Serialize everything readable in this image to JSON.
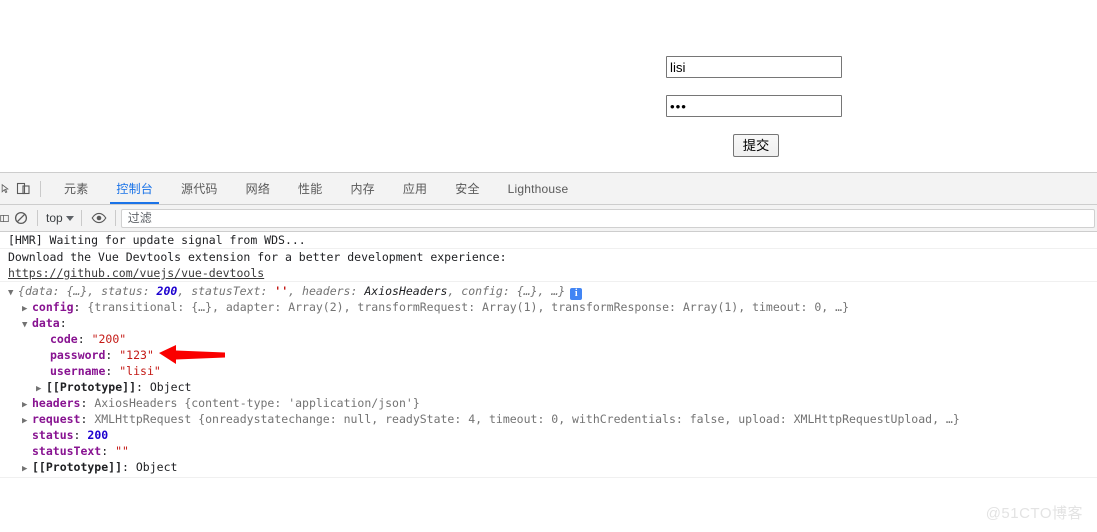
{
  "page": {
    "form": {
      "username_value": "lisi",
      "username_placeholder": "",
      "password_value": "•••",
      "password_placeholder": "",
      "submit_label": "提交"
    }
  },
  "devtools": {
    "left_icons": [
      {
        "name": "inspect-element-icon",
        "glyph": "⌖"
      },
      {
        "name": "device-toolbar-icon",
        "glyph": "device"
      }
    ],
    "tabs": [
      {
        "label": "元素",
        "active": false
      },
      {
        "label": "控制台",
        "active": true
      },
      {
        "label": "源代码",
        "active": false
      },
      {
        "label": "网络",
        "active": false
      },
      {
        "label": "性能",
        "active": false
      },
      {
        "label": "内存",
        "active": false
      },
      {
        "label": "应用",
        "active": false
      },
      {
        "label": "安全",
        "active": false
      },
      {
        "label": "Lighthouse",
        "active": false
      }
    ],
    "filterbar": {
      "clear_console_icon": "no-entry-icon",
      "context_label": "top",
      "eye_icon": "eye-icon",
      "filter_placeholder": "过滤",
      "filter_value": ""
    },
    "console": {
      "messages": [
        {
          "type": "log",
          "text": "[HMR] Waiting for update signal from WDS..."
        },
        {
          "type": "log-with-link",
          "text": "Download the Vue Devtools extension for a better development experience:",
          "link": "https://github.com/vuejs/vue-devtools"
        }
      ],
      "object_summary": {
        "prefix": "{",
        "parts": [
          {
            "key": "data",
            "value": "{…}"
          },
          {
            "key": "status",
            "value": "200"
          },
          {
            "key": "statusText",
            "value": "''"
          },
          {
            "key": "headers",
            "value": "AxiosHeaders"
          },
          {
            "key": "config",
            "value": "{…}"
          }
        ],
        "ellipsis": "…}",
        "info_badge": "i"
      },
      "tree": [
        {
          "indent": 1,
          "marker": "collapsed",
          "key": "config",
          "sep": ": ",
          "value": "{transitional: {…}, adapter: Array(2), transformRequest: Array(1), transformResponse: Array(1), timeout: 0, …}"
        },
        {
          "indent": 1,
          "marker": "expanded",
          "key": "data",
          "sep": ":",
          "value": ""
        },
        {
          "indent": 3,
          "marker": "none",
          "key": "code",
          "sep": ": ",
          "value": "\"200\"",
          "value_kind": "string"
        },
        {
          "indent": 3,
          "marker": "none",
          "key": "password",
          "sep": ": ",
          "value": "\"123\"",
          "value_kind": "string"
        },
        {
          "indent": 3,
          "marker": "none",
          "key": "username",
          "sep": ": ",
          "value": "\"lisi\"",
          "value_kind": "string"
        },
        {
          "indent": 2,
          "marker": "collapsed",
          "key": "[[Prototype]]",
          "sep": ": ",
          "value": "Object",
          "value_kind": "object",
          "key_kind": "proto"
        },
        {
          "indent": 1,
          "marker": "collapsed",
          "key": "headers",
          "sep": ": ",
          "value": "AxiosHeaders {content-type: 'application/json'}"
        },
        {
          "indent": 1,
          "marker": "collapsed",
          "key": "request",
          "sep": ": ",
          "value": "XMLHttpRequest {onreadystatechange: null, readyState: 4, timeout: 0, withCredentials: false, upload: XMLHttpRequestUpload, …}"
        },
        {
          "indent": 1,
          "marker": "none",
          "key": "status",
          "sep": ": ",
          "value": "200",
          "value_kind": "number"
        },
        {
          "indent": 1,
          "marker": "none",
          "key": "statusText",
          "sep": ": ",
          "value": "\"\"",
          "value_kind": "string"
        },
        {
          "indent": 1,
          "marker": "collapsed",
          "key": "[[Prototype]]",
          "sep": ": ",
          "value": "Object",
          "value_kind": "object",
          "key_kind": "proto"
        }
      ]
    }
  },
  "annotation": {
    "arrow_color": "#fa0000",
    "points_to": "password: \"123\""
  },
  "watermark": {
    "text": "@51CTO博客"
  }
}
